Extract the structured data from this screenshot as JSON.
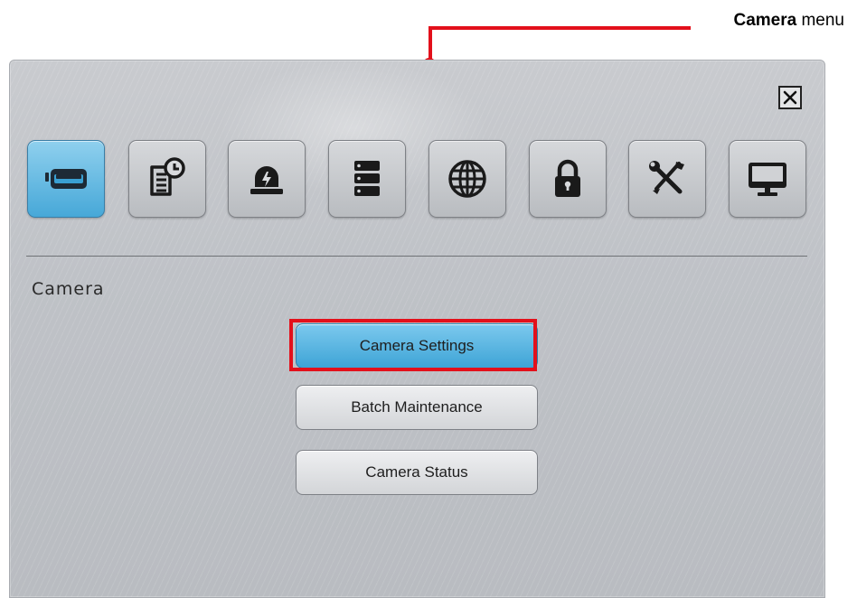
{
  "callout": {
    "bold": "Camera",
    "rest": " menu"
  },
  "dialog": {
    "close_icon": "close-icon",
    "tabs": [
      {
        "name": "camera",
        "icon": "camera-icon",
        "active": true
      },
      {
        "name": "record",
        "icon": "record-schedule-icon",
        "active": false
      },
      {
        "name": "event",
        "icon": "alarm-icon",
        "active": false
      },
      {
        "name": "storage",
        "icon": "storage-icon",
        "active": false
      },
      {
        "name": "network",
        "icon": "globe-icon",
        "active": false
      },
      {
        "name": "security",
        "icon": "lock-icon",
        "active": false
      },
      {
        "name": "system",
        "icon": "tools-icon",
        "active": false
      },
      {
        "name": "display",
        "icon": "monitor-icon",
        "active": false
      }
    ],
    "section_title": "Camera",
    "buttons": [
      {
        "label": "Camera Settings",
        "active": true
      },
      {
        "label": "Batch Maintenance",
        "active": false
      },
      {
        "label": "Camera Status",
        "active": false
      }
    ]
  },
  "colors": {
    "accent_blue": "#47a8d8",
    "callout_red": "#e3101b"
  }
}
